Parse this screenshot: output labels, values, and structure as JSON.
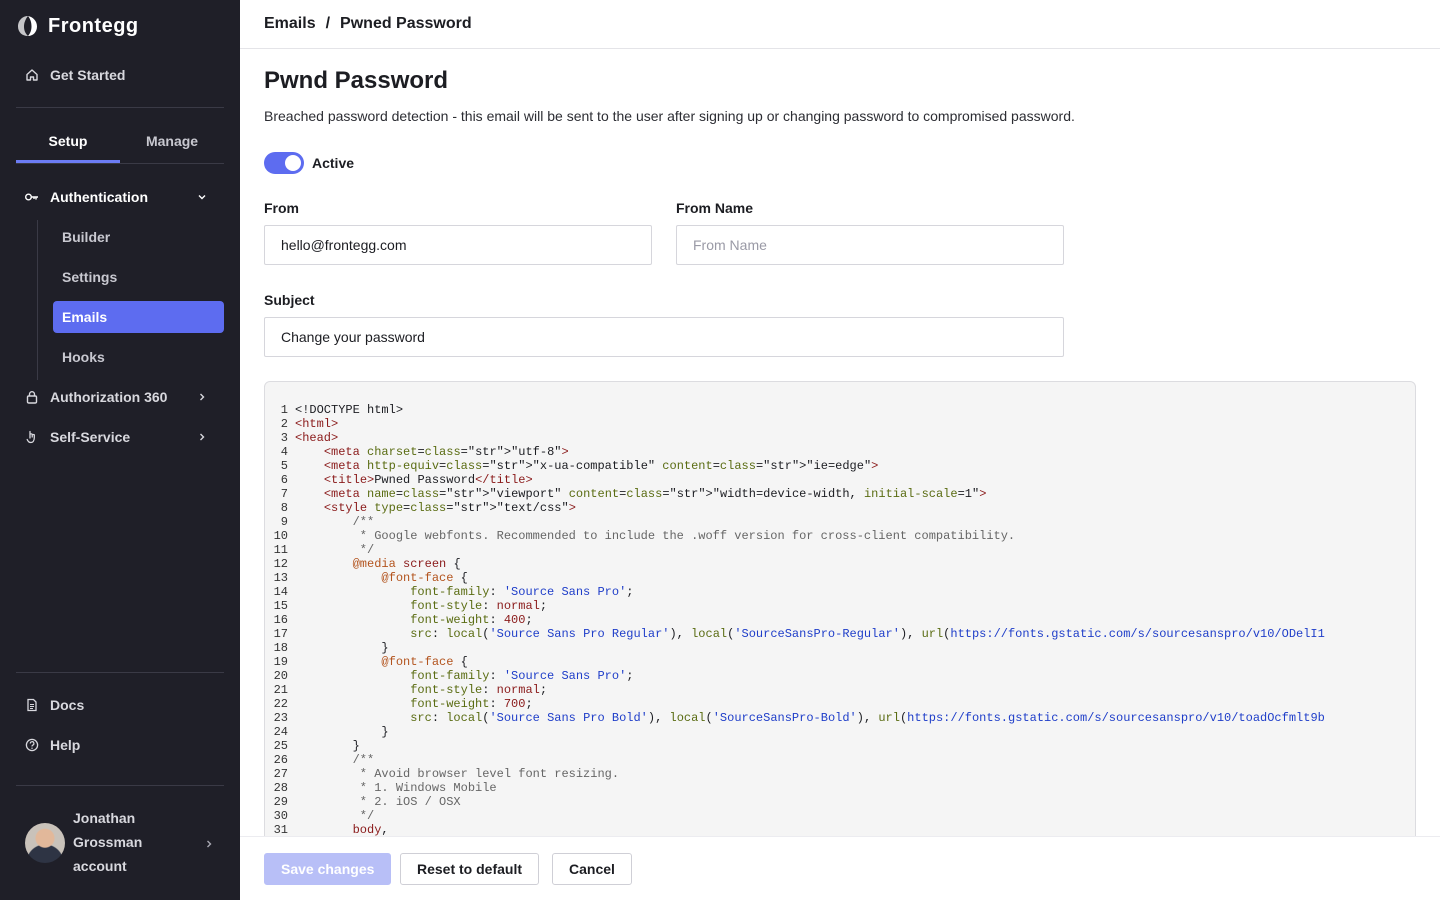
{
  "app": {
    "logo_text": "Frontegg"
  },
  "sidebar": {
    "get_started": "Get Started",
    "tabs": [
      {
        "label": "Setup",
        "active": true
      },
      {
        "label": "Manage",
        "active": false
      }
    ],
    "authentication": "Authentication",
    "sub_items": [
      {
        "label": "Builder",
        "active": false
      },
      {
        "label": "Settings",
        "active": false
      },
      {
        "label": "Emails",
        "active": true
      },
      {
        "label": "Hooks",
        "active": false
      }
    ],
    "authorization": "Authorization 360",
    "self_service": "Self-Service",
    "docs": "Docs",
    "help": "Help",
    "user": {
      "line1": "Jonathan",
      "line2": "Grossman",
      "line3": "account"
    }
  },
  "breadcrumb": {
    "parent": "Emails",
    "separator": "/",
    "current": "Pwned Password"
  },
  "page": {
    "title": "Pwnd Password",
    "description": "Breached password detection - this email will be sent to the user after signing up or changing password to compromised password.",
    "active_label": "Active",
    "active": true
  },
  "form": {
    "from_label": "From",
    "from_value": "hello@frontegg.com",
    "from_name_label": "From Name",
    "from_name_placeholder": "From Name",
    "subject_label": "Subject",
    "subject_value": "Change your password"
  },
  "code": {
    "lines": [
      {
        "n": "1",
        "t": "<!DOCTYPE html>"
      },
      {
        "n": "2",
        "t": "<html>"
      },
      {
        "n": "3",
        "t": "<head>"
      },
      {
        "n": "4",
        "t": "    <meta charset=\"utf-8\">"
      },
      {
        "n": "5",
        "t": "    <meta http-equiv=\"x-ua-compatible\" content=\"ie=edge\">"
      },
      {
        "n": "6",
        "t": "    <title>Pwned Password</title>"
      },
      {
        "n": "7",
        "t": "    <meta name=\"viewport\" content=\"width=device-width, initial-scale=1\">"
      },
      {
        "n": "8",
        "t": "    <style type=\"text/css\">"
      },
      {
        "n": "9",
        "t": "        /**"
      },
      {
        "n": "10",
        "t": "         * Google webfonts. Recommended to include the .woff version for cross-client compatibility."
      },
      {
        "n": "11",
        "t": "         */"
      },
      {
        "n": "12",
        "t": "        @media screen {"
      },
      {
        "n": "13",
        "t": "            @font-face {"
      },
      {
        "n": "14",
        "t": "                font-family: 'Source Sans Pro';"
      },
      {
        "n": "15",
        "t": "                font-style: normal;"
      },
      {
        "n": "16",
        "t": "                font-weight: 400;"
      },
      {
        "n": "17",
        "t": "                src: local('Source Sans Pro Regular'), local('SourceSansPro-Regular'), url(https://fonts.gstatic.com/s/sourcesanspro/v10/ODelI1"
      },
      {
        "n": "18",
        "t": "            }"
      },
      {
        "n": "19",
        "t": "            @font-face {"
      },
      {
        "n": "20",
        "t": "                font-family: 'Source Sans Pro';"
      },
      {
        "n": "21",
        "t": "                font-style: normal;"
      },
      {
        "n": "22",
        "t": "                font-weight: 700;"
      },
      {
        "n": "23",
        "t": "                src: local('Source Sans Pro Bold'), local('SourceSansPro-Bold'), url(https://fonts.gstatic.com/s/sourcesanspro/v10/toadOcfmlt9b"
      },
      {
        "n": "24",
        "t": "            }"
      },
      {
        "n": "25",
        "t": "        }"
      },
      {
        "n": "26",
        "t": "        /**"
      },
      {
        "n": "27",
        "t": "         * Avoid browser level font resizing."
      },
      {
        "n": "28",
        "t": "         * 1. Windows Mobile"
      },
      {
        "n": "29",
        "t": "         * 2. iOS / OSX"
      },
      {
        "n": "30",
        "t": "         */"
      },
      {
        "n": "31",
        "t": "        body,"
      }
    ]
  },
  "footer": {
    "save_label": "Save changes",
    "reset_label": "Reset to default",
    "cancel_label": "Cancel"
  },
  "colors": {
    "sidebar_bg": "#1f1f28",
    "accent": "#5d6cf0",
    "save_disabled": "#b8bff7"
  }
}
